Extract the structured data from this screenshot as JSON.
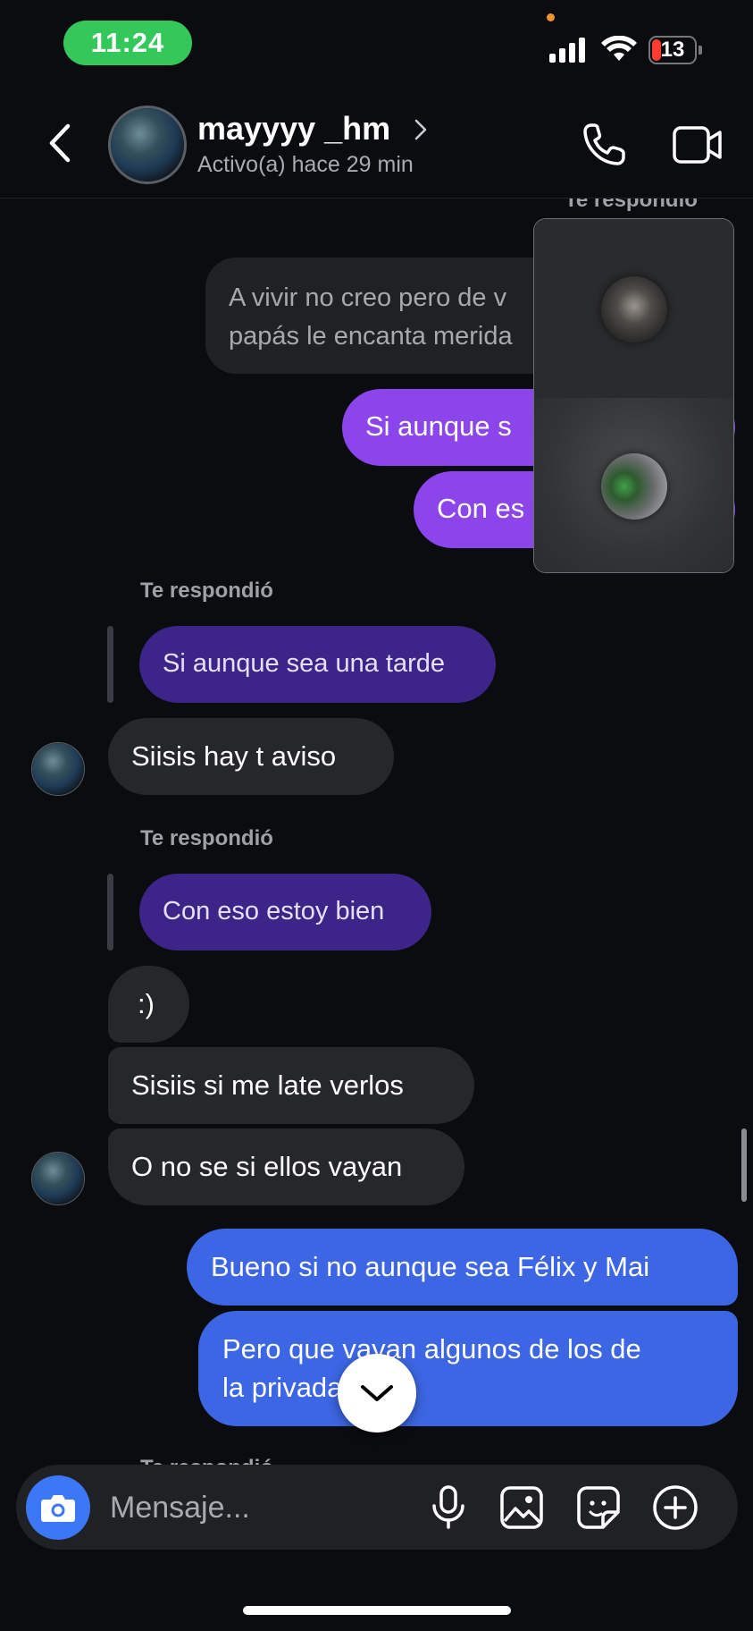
{
  "status_bar": {
    "time": "11:24",
    "battery": "13"
  },
  "header": {
    "username": "mayyyy _hm",
    "active_status": "Activo(a) hace 29 min"
  },
  "top_partial_label": "Te respondió",
  "messages": {
    "received_top": "A vivir no creo pero de v\npapás le encanta merida",
    "sent_purple_1": "Si aunque s",
    "sent_purple_2": "Con es",
    "reply_label_1": "Te respondió",
    "quoted_1": "Si aunque sea una tarde",
    "received_1": "Siisis hay t aviso",
    "reply_label_2": "Te respondió",
    "quoted_2": "Con eso estoy bien",
    "received_2": ":)",
    "received_3": "Sisiis si me late verlos",
    "received_4": "O no se si ellos vayan",
    "sent_blue_1": "Bueno si no aunque sea Félix y Mai",
    "sent_blue_2": "Pero que vayan algunos de los de\nla privada",
    "bottom_partial_label": "Te respondió"
  },
  "composer": {
    "placeholder": "Mensaje..."
  },
  "colors": {
    "background": "#0b0c0f",
    "sent_purple": "#8b45ea",
    "quoted_purple": "#3d2489",
    "sent_blue": "#3c66e3",
    "received_gray": "#26272b",
    "status_green": "#34c759",
    "camera_blue": "#3c77f6"
  },
  "icons": {
    "back": "chevron-left-icon",
    "header_chevron": "chevron-right-icon",
    "call": "phone-icon",
    "video": "video-camera-icon",
    "camera": "camera-icon",
    "mic": "microphone-icon",
    "gallery": "image-icon",
    "sticker": "sticker-icon",
    "more": "plus-circle-icon",
    "scroll_down": "chevron-down-icon"
  }
}
